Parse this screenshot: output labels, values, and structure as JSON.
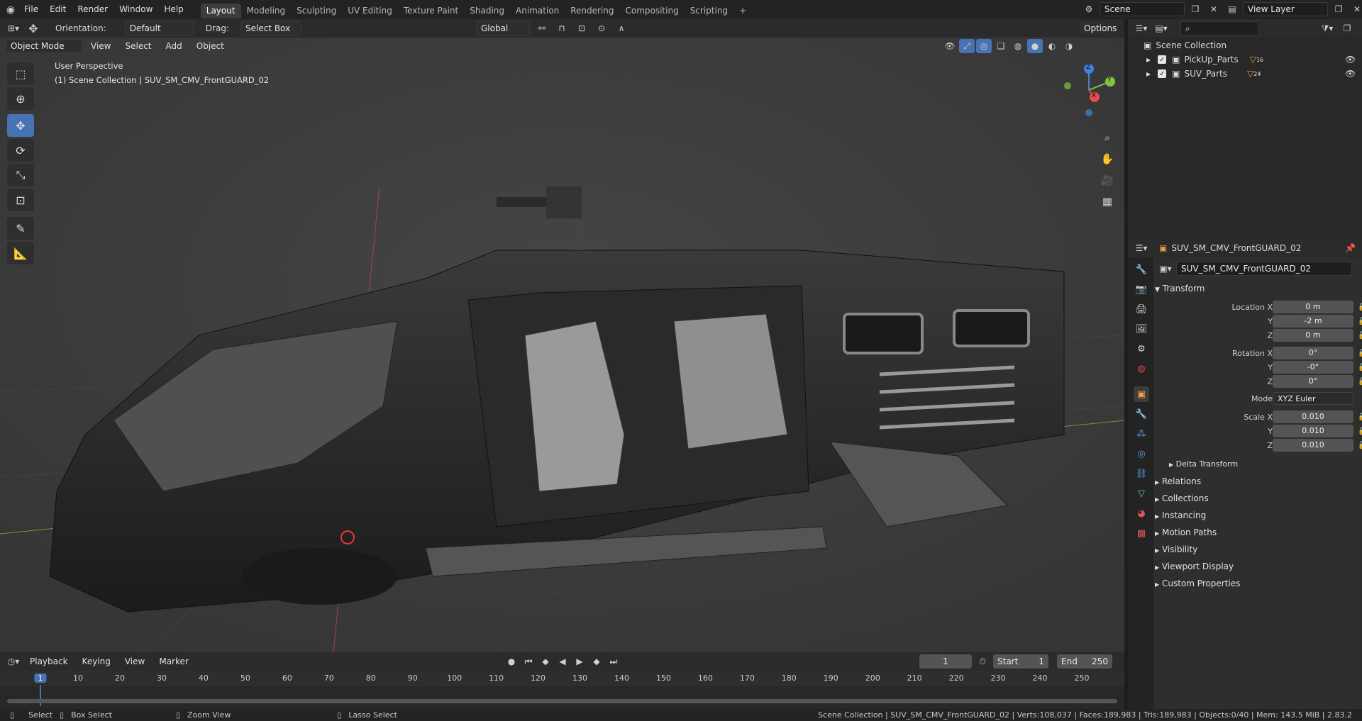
{
  "topbar": {
    "menus": [
      "File",
      "Edit",
      "Render",
      "Window",
      "Help"
    ],
    "workspaces": [
      "Layout",
      "Modeling",
      "Sculpting",
      "UV Editing",
      "Texture Paint",
      "Shading",
      "Animation",
      "Rendering",
      "Compositing",
      "Scripting"
    ],
    "active_workspace": "Layout",
    "add_tab": "+",
    "scene": "Scene",
    "view_layer": "View Layer"
  },
  "vp_header": {
    "orientation_label": "Orientation:",
    "orientation_value": "Default",
    "drag_label": "Drag:",
    "drag_value": "Select Box",
    "transform_space": "Global",
    "options": "Options"
  },
  "vp_header2": {
    "mode": "Object Mode",
    "menus": [
      "View",
      "Select",
      "Add",
      "Object"
    ]
  },
  "viewport": {
    "perspective": "User Perspective",
    "context": "(1) Scene Collection | SUV_SM_CMV_FrontGUARD_02",
    "gizmo": {
      "x": "X",
      "y": "Y",
      "z": "Z"
    }
  },
  "outliner": {
    "root": "Scene Collection",
    "items": [
      {
        "name": "PickUp_Parts",
        "count": "16"
      },
      {
        "name": "SUV_Parts",
        "count": "24"
      }
    ]
  },
  "properties": {
    "object_name": "SUV_SM_CMV_FrontGUARD_02",
    "object_field": "SUV_SM_CMV_FrontGUARD_02",
    "transform_title": "Transform",
    "location": {
      "label_x": "Location X",
      "x": "0 m",
      "label_y": "Y",
      "y": "-2 m",
      "label_z": "Z",
      "z": "0 m"
    },
    "rotation": {
      "label_x": "Rotation X",
      "x": "0°",
      "label_y": "Y",
      "y": "-0°",
      "label_z": "Z",
      "z": "0°"
    },
    "mode_label": "Mode",
    "mode_value": "XYZ Euler",
    "scale": {
      "label_x": "Scale X",
      "x": "0.010",
      "label_y": "Y",
      "y": "0.010",
      "label_z": "Z",
      "z": "0.010"
    },
    "delta_transform": "Delta Transform",
    "sections": [
      "Relations",
      "Collections",
      "Instancing",
      "Motion Paths",
      "Visibility",
      "Viewport Display",
      "Custom Properties"
    ]
  },
  "timeline": {
    "menus": [
      "Playback",
      "Keying",
      "View",
      "Marker"
    ],
    "current_frame": "1",
    "start_label": "Start",
    "start": "1",
    "end_label": "End",
    "end": "250",
    "ticks": [
      "1",
      "10",
      "20",
      "30",
      "40",
      "50",
      "60",
      "70",
      "80",
      "90",
      "100",
      "110",
      "120",
      "130",
      "140",
      "150",
      "160",
      "170",
      "180",
      "190",
      "200",
      "210",
      "220",
      "230",
      "240",
      "250"
    ]
  },
  "status": {
    "select": "Select",
    "box_select": "Box Select",
    "zoom_view": "Zoom View",
    "lasso_select": "Lasso Select",
    "info": "Scene Collection | SUV_SM_CMV_FrontGUARD_02 | Verts:108,037 | Faces:189,983 | Tris:189,983 | Objects:0/40 | Mem: 143.5 MiB | 2.83.2"
  },
  "colors": {
    "accent": "#4772b3",
    "x_axis": "#e64d4d",
    "y_axis": "#7ec63c",
    "z_axis": "#3d84d9"
  }
}
